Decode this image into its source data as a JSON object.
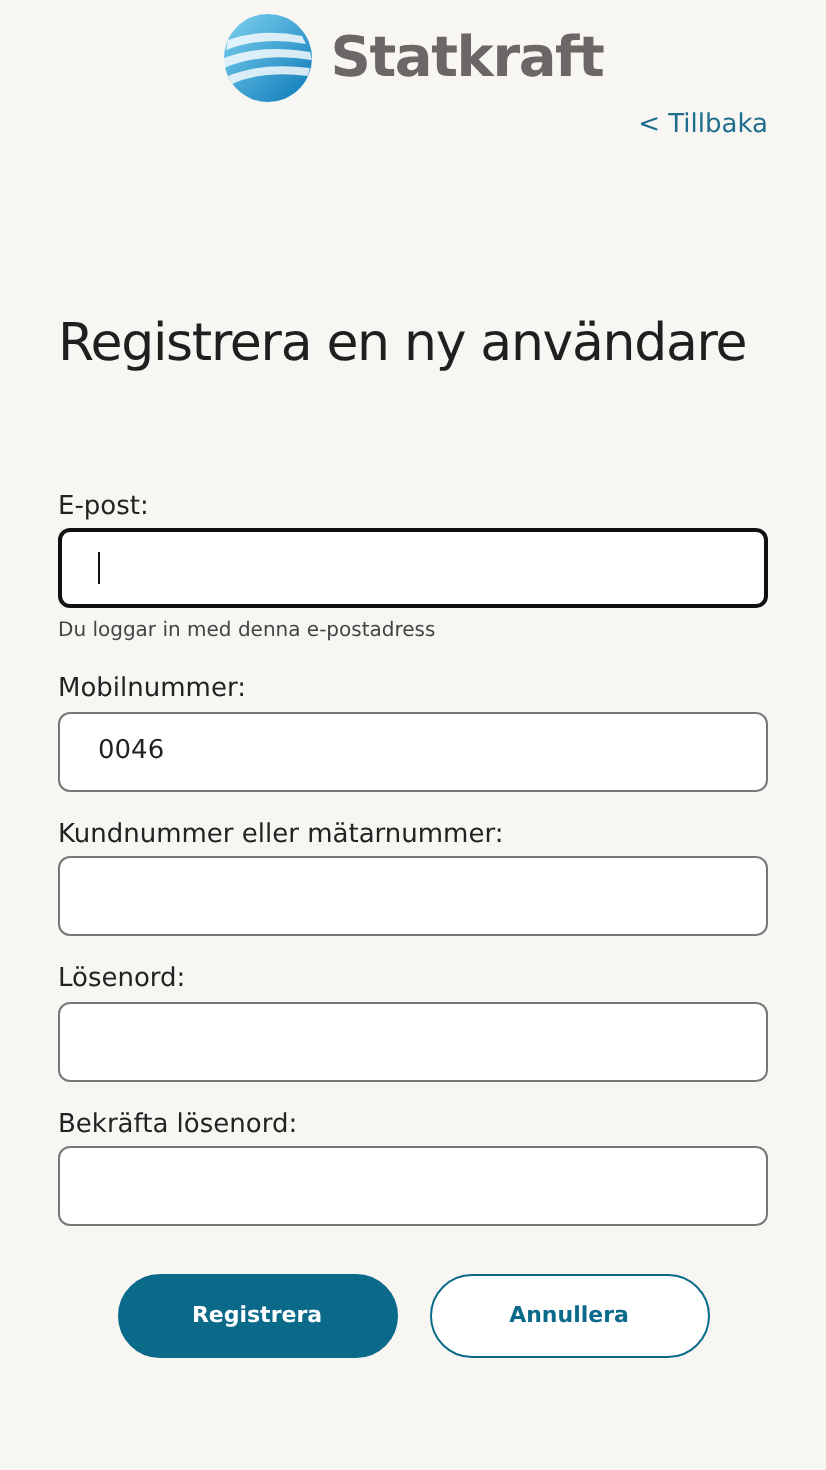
{
  "header": {
    "logo_text": "Statkraft",
    "back_link": "< Tillbaka"
  },
  "title": "Registrera en ny användare",
  "fields": [
    {
      "label": "E-post:",
      "focused": true,
      "helper": "Du loggar in med denna e-postadress"
    },
    {
      "label": "Mobilnummer:",
      "value": "0046",
      "focused": false
    },
    {
      "label": "Kundnummer eller mätarnummer:",
      "focused": false
    },
    {
      "label": "Lösenord:",
      "focused": false
    },
    {
      "label": "Bekräfta lösenord:",
      "focused": false
    }
  ],
  "buttons": [
    {
      "label": "Registrera",
      "kind": "primary"
    },
    {
      "label": "Annullera",
      "kind": "secondary"
    }
  ]
}
